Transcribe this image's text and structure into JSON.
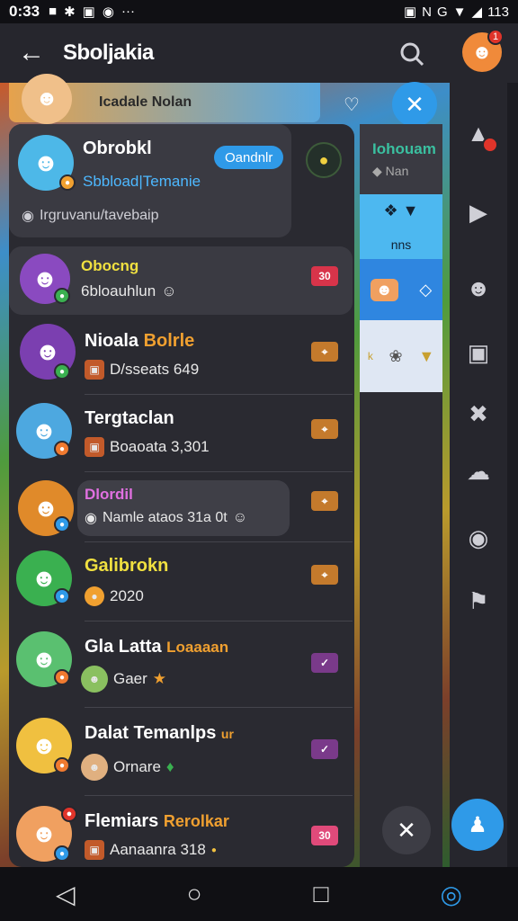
{
  "status_bar": {
    "time": "0:33",
    "icons": [
      "notification-icon",
      "bluetooth-icon",
      "square-icon",
      "chat-icon",
      "more-icon"
    ],
    "more": "···",
    "right": [
      "nfc-icon",
      "n-icon",
      "g-icon",
      "wifi-icon",
      "signal-icon"
    ],
    "n_letter": "N",
    "g_letter": "G",
    "battery": "113"
  },
  "app_bar": {
    "title": "Sboljakia",
    "profile_badge": "1"
  },
  "banner": {
    "text": "Icadale Nolan"
  },
  "top_card": {
    "name": "Obrobkl",
    "pill": "Oandnlr",
    "link": "Sbbload|Temanie",
    "meta": "Irgruvanu/tavebaip"
  },
  "second_card": {
    "name": "Obocng",
    "sub": "6bloauhlun",
    "tag": "30"
  },
  "list": [
    {
      "name": "Nioala",
      "name_accent": "Bolrle",
      "sub": "D/sseats 649",
      "tag": "⌖"
    },
    {
      "name": "Tergtaclan",
      "name_accent": "",
      "sub": "Boaoata 3,301",
      "tag": "⌖"
    },
    {
      "name": "Dlordil",
      "name_accent": "",
      "sub": "Namle ataos 31a 0t",
      "tag": "⌖"
    },
    {
      "name": "Galibrokn",
      "name_accent": "",
      "sub": "2020",
      "tag": "⌖"
    },
    {
      "name": "Gla Latta",
      "name_accent": "Loaaaan",
      "sub": "Gaer",
      "tag": "✓"
    },
    {
      "name": "Dalat Temanlps",
      "name_accent": "ur",
      "sub": "Ornare",
      "tag": "✓"
    },
    {
      "name": "Flemiars",
      "name_accent": "Rerolkar",
      "sub": "Aanaanra 318",
      "tag": "30"
    }
  ],
  "side_panel": {
    "title": "Iohouam",
    "sub": "Nan",
    "blue_text": "nns",
    "k_text": "k"
  },
  "colors": {
    "accent": "#2f9ae8",
    "panel": "#2a2a31",
    "card": "#3a3a42",
    "name_orange": "#f0a030",
    "name_yellow": "#f0e040",
    "tag_orange": "#c47a2c",
    "tag_purple": "#7a3a8a",
    "tag_pink": "#e04a7a"
  }
}
